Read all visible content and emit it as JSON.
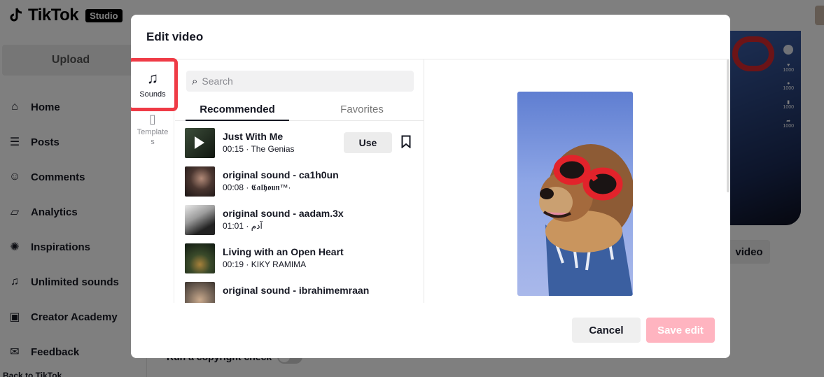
{
  "app": {
    "logo_text": "TikTok",
    "logo_badge": "Studio"
  },
  "sidebar": {
    "upload_label": "Upload",
    "items": [
      {
        "label": "Home",
        "icon": "home-icon"
      },
      {
        "label": "Posts",
        "icon": "list-icon"
      },
      {
        "label": "Comments",
        "icon": "comment-icon"
      },
      {
        "label": "Analytics",
        "icon": "analytics-icon"
      },
      {
        "label": "Inspirations",
        "icon": "lightbulb-icon"
      },
      {
        "label": "Unlimited sounds",
        "icon": "music-list-icon"
      },
      {
        "label": "Creator Academy",
        "icon": "academy-icon"
      },
      {
        "label": "Feedback",
        "icon": "feedback-icon"
      }
    ],
    "back_label": "Back to TikTok"
  },
  "background": {
    "edit_video_label": "video",
    "copyright_label": "Run a copyright check",
    "preview_counts": [
      "1000",
      "1000",
      "1000",
      "1000"
    ]
  },
  "modal": {
    "title": "Edit video",
    "tools": {
      "sounds_label": "Sounds",
      "templates_label": "Templates"
    },
    "search": {
      "placeholder": "Search",
      "value": ""
    },
    "tabs": [
      {
        "label": "Recommended",
        "active": true
      },
      {
        "label": "Favorites",
        "active": false
      }
    ],
    "use_label": "Use",
    "sounds": [
      {
        "title": "Just With Me",
        "meta": "00:15 · The Genias",
        "selected": true
      },
      {
        "title": "original sound - ca1h0un",
        "meta": "00:08 · 𝕮𝖆𝖑𝖍𝖔𝖚𝖓™·",
        "selected": false
      },
      {
        "title": "original sound - aadam.3x",
        "meta": "01:01 · آدم",
        "selected": false
      },
      {
        "title": "Living with an Open Heart",
        "meta": "00:19 · KIKY RAMIMA",
        "selected": false
      },
      {
        "title": "original sound - ibrahimemraan",
        "meta": "",
        "selected": false
      }
    ],
    "cancel_label": "Cancel",
    "save_label": "Save edit"
  },
  "colors": {
    "accent_red": "#ef3b46",
    "save_disabled": "#ffb4c0",
    "overlay": "rgba(0,0,0,0.5)"
  }
}
